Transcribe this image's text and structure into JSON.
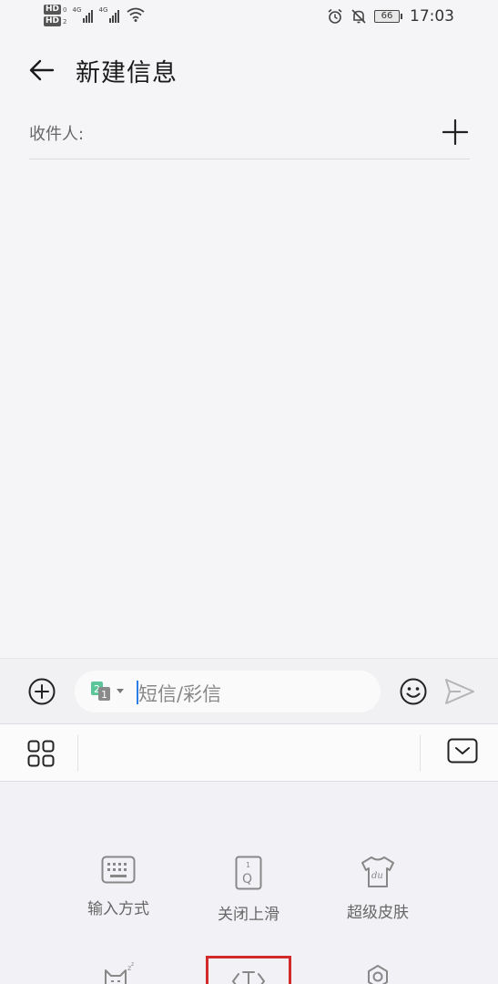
{
  "status_bar": {
    "hd1": "HD",
    "hd1_sub": "0",
    "hd2": "HD",
    "hd2_sub": "2",
    "sim1_tag": "4G",
    "sim2_tag": "4G",
    "battery": "66",
    "time": "17:03"
  },
  "header": {
    "title": "新建信息"
  },
  "recipient": {
    "label": "收件人:"
  },
  "compose": {
    "placeholder": "短信/彩信",
    "sim_front": "2",
    "sim_back": "1"
  },
  "keyboard_panel": {
    "tiles": [
      {
        "label": "输入方式",
        "icon": "keyboard-icon"
      },
      {
        "label": "关闭上滑",
        "icon": "swipe-off-icon"
      },
      {
        "label": "超级皮肤",
        "icon": "tshirt-icon"
      },
      {
        "label": "",
        "icon": "cat-sleep-icon"
      },
      {
        "label": "",
        "icon": "text-cursor-icon"
      },
      {
        "label": "",
        "icon": "settings-icon"
      }
    ]
  },
  "colors": {
    "accent": "#2a7ee6",
    "highlight": "#d22a2a",
    "sim_green": "#5cc59a"
  }
}
